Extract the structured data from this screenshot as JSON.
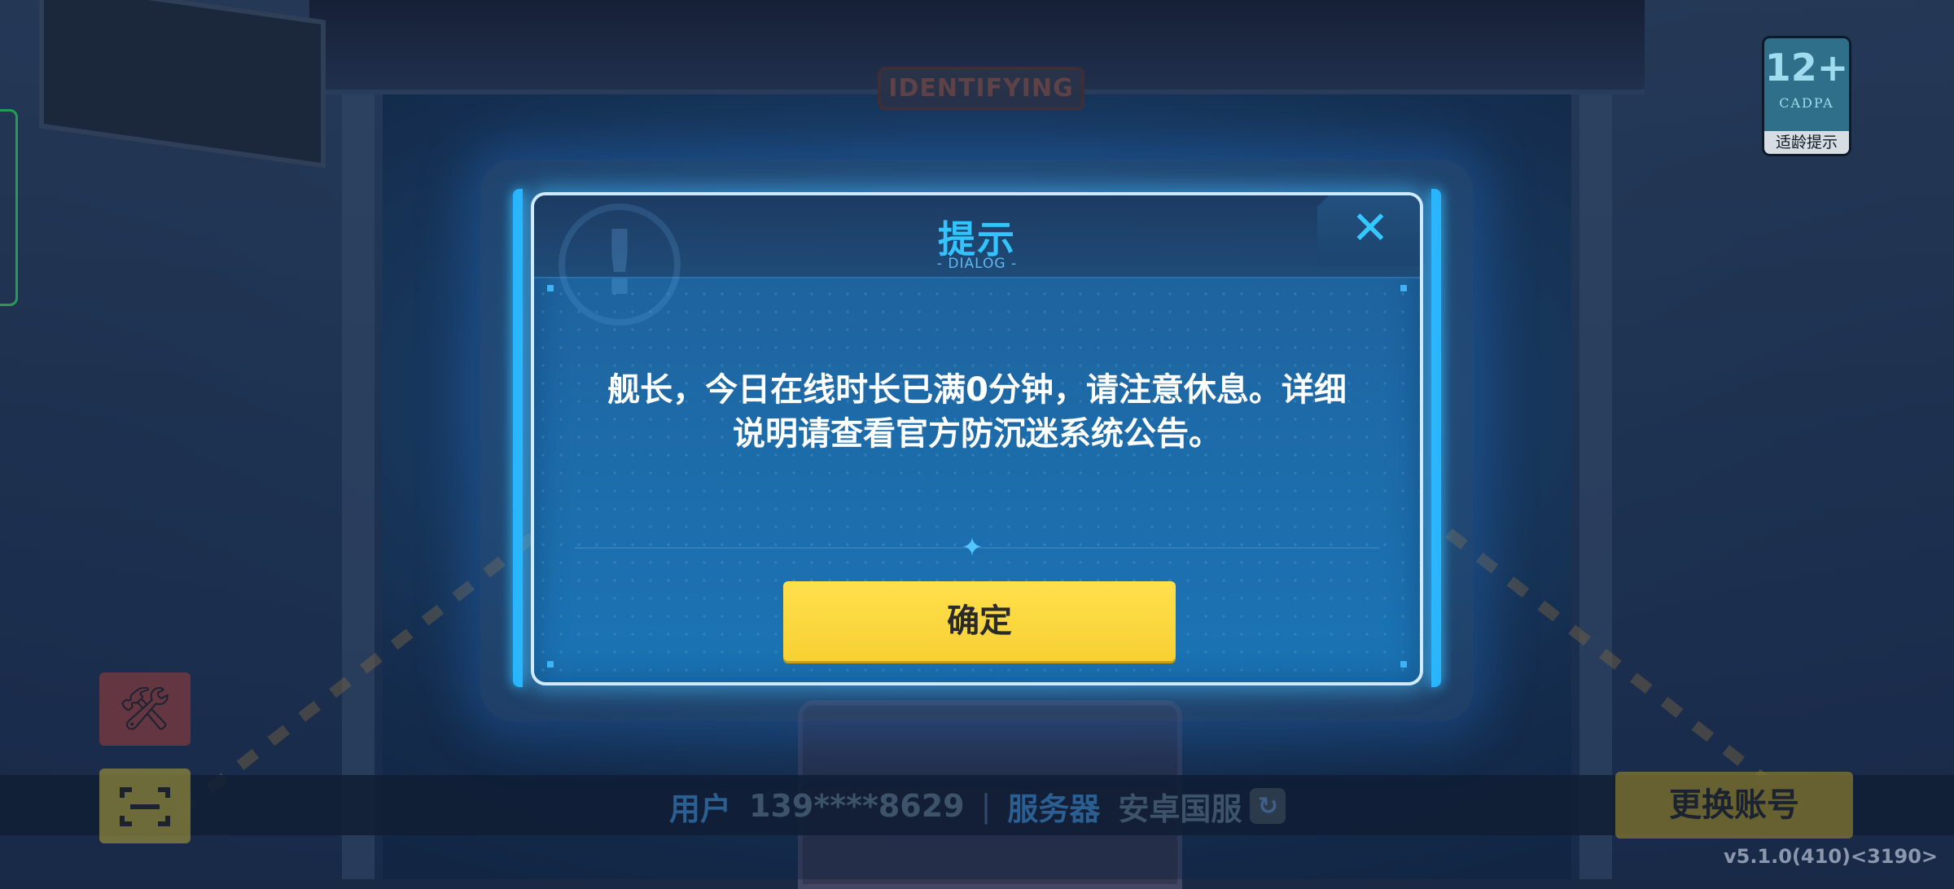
{
  "background": {
    "sign_text": "IDENTIFYING"
  },
  "age_rating": {
    "age": "12+",
    "brand": "CADPA",
    "label": "适龄提示"
  },
  "dialog": {
    "title": "提示",
    "subtitle": "- DIALOG -",
    "close_icon": "close-icon",
    "message_line1": "舰长，今日在线时长已满0分钟，请注意休息。详细",
    "message_line2": "说明请查看官方防沉迷系统公告。",
    "confirm_label": "确定",
    "accent_color": "#33c4ff",
    "button_color": "#ffe04d"
  },
  "bottom_bar": {
    "user_label": "用户",
    "user_value": "139****8629",
    "separator": "|",
    "server_label": "服务器",
    "server_value": "安卓国服",
    "refresh_icon": "refresh-icon",
    "switch_account_label": "更换账号",
    "version": "v5.1.0(410)<3190>",
    "tools_icon": "tools-icon",
    "scan_icon": "scan-icon"
  }
}
